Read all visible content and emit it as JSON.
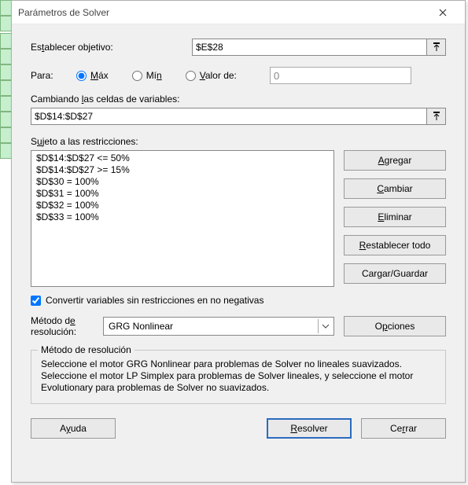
{
  "window": {
    "title": "Parámetros de Solver"
  },
  "objective": {
    "label_pre": "Es",
    "label_u": "t",
    "label_post": "ablecer objetivo:",
    "value": "$E$28"
  },
  "para": {
    "label": "Para:",
    "max_u": "M",
    "max_post": "áx",
    "min_pre": "Mí",
    "min_u": "n",
    "valor_u": "V",
    "valor_post": "alor de:",
    "valor_value": "0",
    "selected": "max"
  },
  "changing": {
    "label_pre": "Cambiando ",
    "label_u": "l",
    "label_post": "as celdas de variables:",
    "value": "$D$14:$D$27"
  },
  "constraints": {
    "label_pre": "S",
    "label_u": "u",
    "label_post": "jeto a las restricciones:",
    "items": [
      "$D$14:$D$27 <= 50%",
      "$D$14:$D$27 >= 15%",
      "$D$30 = 100%",
      "$D$31 = 100%",
      "$D$32 = 100%",
      "$D$33 = 100%"
    ]
  },
  "buttons": {
    "add_u": "A",
    "add_post": "gregar",
    "change_u": "C",
    "change_post": "ambiar",
    "delete_u": "E",
    "delete_post": "liminar",
    "reset_u": "R",
    "reset_post": "establecer todo",
    "load_pre": "Car",
    "load_u": "g",
    "load_post": "ar/Guardar",
    "options_pre": "O",
    "options_u": "p",
    "options_post": "ciones",
    "help_pre": "A",
    "help_u": "y",
    "help_post": "uda",
    "solve_u": "R",
    "solve_post": "esolver",
    "close_pre": "Ce",
    "close_u": "r",
    "close_post": "rar"
  },
  "nonneg": {
    "label": "Convertir variables sin restricciones en no negativas",
    "checked": true
  },
  "method": {
    "label": "Método d_e resolución:",
    "value": "GRG Nonlinear"
  },
  "group": {
    "label": "Método de resolución",
    "desc": "Seleccione el motor GRG Nonlinear para problemas de Solver no lineales suavizados. Seleccione el motor LP Simplex para problemas de Solver lineales, y seleccione el motor Evolutionary para problemas de Solver no suavizados."
  }
}
